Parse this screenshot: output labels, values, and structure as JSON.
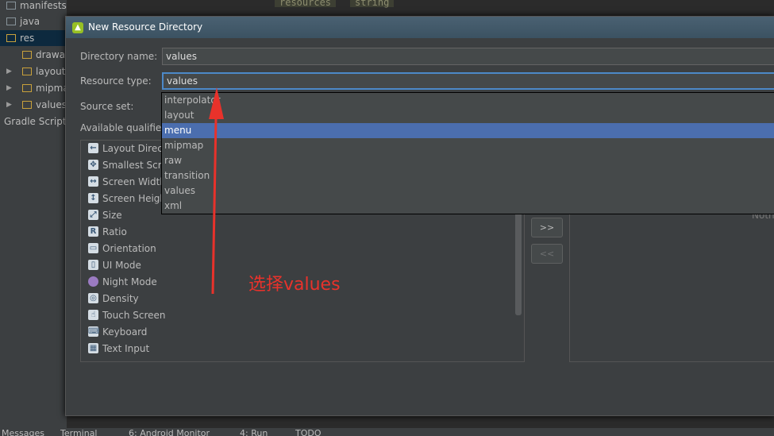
{
  "tree": {
    "items": [
      {
        "label": "manifests",
        "has_arrow": false
      },
      {
        "label": "java",
        "has_arrow": false
      },
      {
        "label": "res",
        "has_arrow": false
      },
      {
        "label": "drawa",
        "has_arrow": false
      },
      {
        "label": "layout",
        "has_arrow": true
      },
      {
        "label": "mipma",
        "has_arrow": true
      },
      {
        "label": "values",
        "has_arrow": true
      },
      {
        "label": "Gradle Script",
        "has_arrow": false
      }
    ]
  },
  "editor": {
    "tabs": [
      "resources",
      "string"
    ]
  },
  "dialog": {
    "title": "New Resource Directory",
    "directory_name_label": "Directory name:",
    "directory_name_value": "values",
    "resource_type_label": "Resource type:",
    "resource_type_value": "values",
    "source_set_label": "Source set:",
    "available_qualifiers_label": "Available qualifier",
    "qualifiers": [
      {
        "label": "Layout Direct",
        "icon": "layout-direction-icon",
        "glyph": "←"
      },
      {
        "label": "Smallest Scre",
        "icon": "smallest-screen-icon",
        "glyph": "✥"
      },
      {
        "label": "Screen Width",
        "icon": "screen-width-icon",
        "glyph": "↔"
      },
      {
        "label": "Screen Heigh",
        "icon": "screen-height-icon",
        "glyph": "↕"
      },
      {
        "label": "Size",
        "icon": "size-icon",
        "glyph": "⤢"
      },
      {
        "label": "Ratio",
        "icon": "ratio-icon",
        "glyph": "R"
      },
      {
        "label": "Orientation",
        "icon": "orientation-icon",
        "glyph": "▭"
      },
      {
        "label": "UI Mode",
        "icon": "ui-mode-icon",
        "glyph": "▯"
      },
      {
        "label": "Night Mode",
        "icon": "night-mode-icon",
        "glyph": "●"
      },
      {
        "label": "Density",
        "icon": "density-icon",
        "glyph": "◎"
      },
      {
        "label": "Touch Screen",
        "icon": "touch-screen-icon",
        "glyph": "☝"
      },
      {
        "label": "Keyboard",
        "icon": "keyboard-icon",
        "glyph": "⌨"
      },
      {
        "label": "Text Input",
        "icon": "text-input-icon",
        "glyph": "▦"
      }
    ],
    "add_button_label": ">>",
    "remove_button_label": "<<",
    "chosen_placeholder": "Noth"
  },
  "dropdown": {
    "options": [
      "interpolator",
      "layout",
      "menu",
      "mipmap",
      "raw",
      "transition",
      "values",
      "xml"
    ],
    "selected": "menu"
  },
  "annotation": {
    "text": "选择values",
    "color": "#e8322b"
  },
  "bottom_bar": {
    "tabs": [
      "Messages",
      "Terminal",
      "6: Android Monitor",
      "4: Run",
      "TODO"
    ]
  },
  "colors": {
    "selection": "#4b6eaf",
    "focus_border": "#4c89c8",
    "annotation": "#e8322b"
  }
}
